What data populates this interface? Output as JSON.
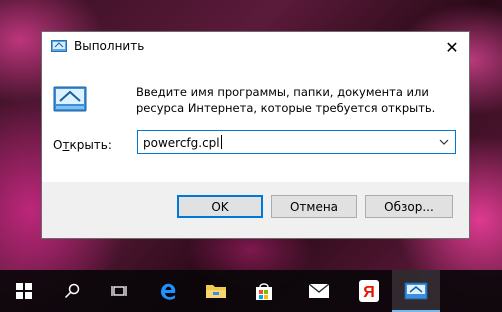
{
  "dialog": {
    "title": "Выполнить",
    "close_symbol": "✕",
    "description": "Введите имя программы, папки, документа или ресурса Интернета, которые требуется открыть.",
    "open_label_prefix": "О",
    "open_label_underlined": "т",
    "open_label_suffix": "крыть:",
    "input_value": "powercfg.cpl",
    "buttons": {
      "ok": "OK",
      "cancel": "Отмена",
      "browse": "Обзор..."
    },
    "icons": {
      "title": "run-icon",
      "content": "run-icon",
      "dropdown": "chevron-down-icon"
    }
  },
  "taskbar": {
    "items": [
      {
        "name": "start",
        "icon": "windows-logo-icon"
      },
      {
        "name": "search",
        "icon": "search-icon"
      },
      {
        "name": "task-view",
        "icon": "task-view-icon"
      },
      {
        "name": "edge",
        "icon": "edge-icon"
      },
      {
        "name": "file-explorer",
        "icon": "folder-icon"
      },
      {
        "name": "store",
        "icon": "store-icon"
      },
      {
        "name": "mail",
        "icon": "mail-icon"
      },
      {
        "name": "yandex",
        "icon": "yandex-icon",
        "glyph": "Я"
      },
      {
        "name": "run",
        "icon": "run-icon",
        "active": true
      }
    ]
  },
  "colors": {
    "accent": "#0078d7",
    "taskbar": "#0a060a",
    "dialog_bg": "#f0f0f0"
  }
}
